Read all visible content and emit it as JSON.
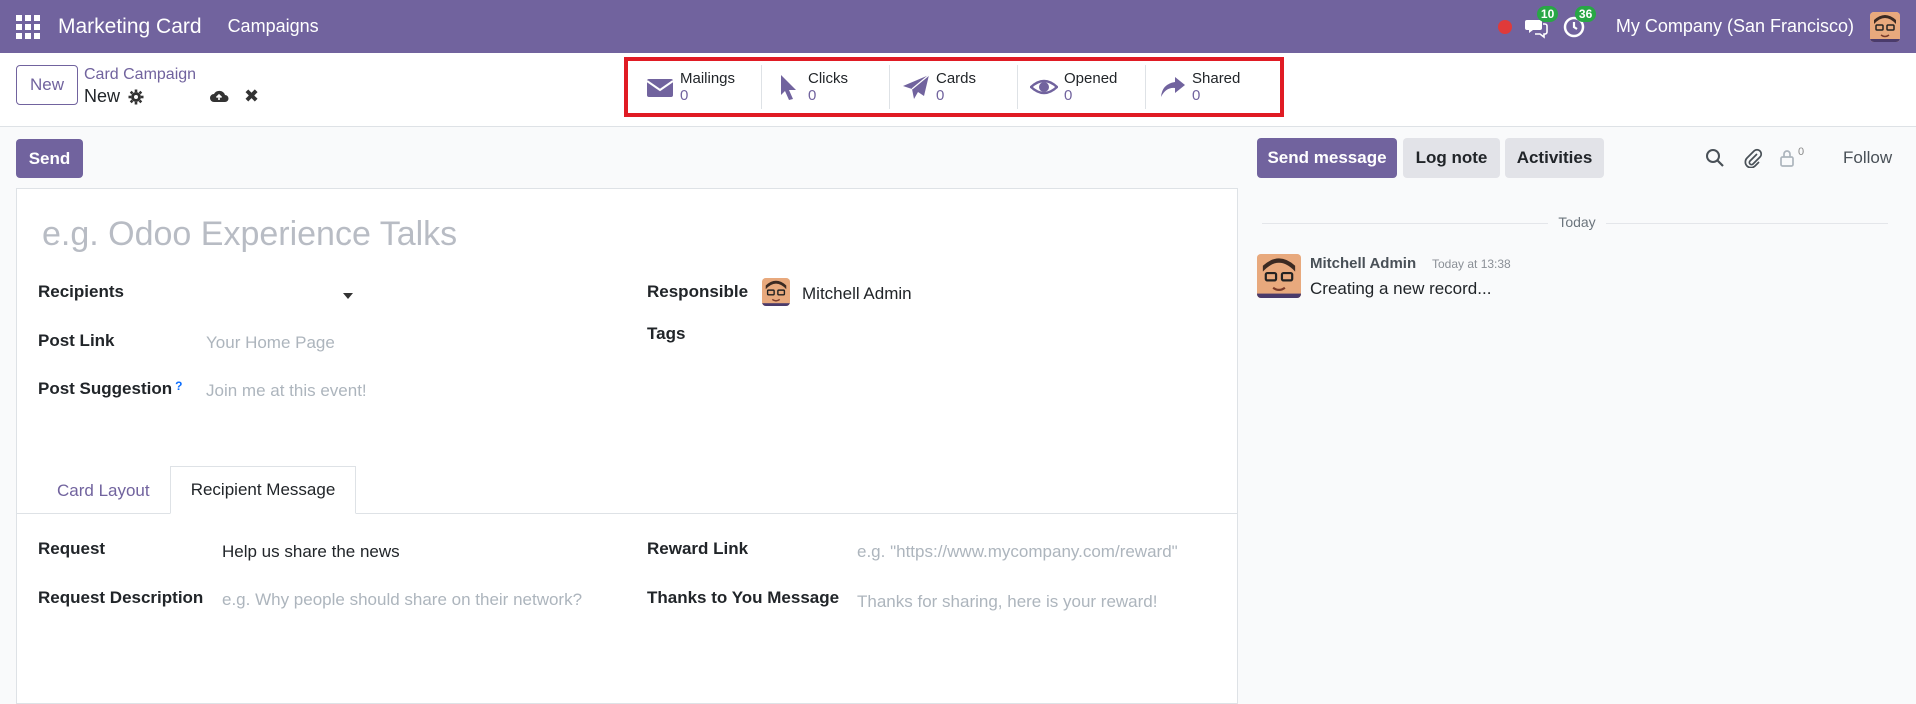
{
  "navbar": {
    "app_name": "Marketing Card",
    "menu": "Campaigns",
    "messages_badge": "10",
    "activities_badge": "36",
    "company": "My Company (San Francisco)",
    "accent_color": "#71639e"
  },
  "control_panel": {
    "new_label": "New",
    "breadcrumb_parent": "Card Campaign",
    "breadcrumb_current": "New",
    "stats": [
      {
        "icon": "envelope-icon",
        "label": "Mailings",
        "value": "0"
      },
      {
        "icon": "cursor-icon",
        "label": "Clicks",
        "value": "0"
      },
      {
        "icon": "paper-plane-icon",
        "label": "Cards",
        "value": "0"
      },
      {
        "icon": "eye-icon",
        "label": "Opened",
        "value": "0"
      },
      {
        "icon": "share-icon",
        "label": "Shared",
        "value": "0"
      }
    ]
  },
  "status_bar": {
    "send_label": "Send"
  },
  "form": {
    "name_placeholder": "e.g. Odoo Experience Talks",
    "recipients_label": "Recipients",
    "post_link_label": "Post Link",
    "post_link_placeholder": "Your Home Page",
    "post_suggestion_label": "Post Suggestion",
    "post_suggestion_help": "?",
    "post_suggestion_placeholder": "Join me at this event!",
    "responsible_label": "Responsible",
    "responsible_value": "Mitchell Admin",
    "tags_label": "Tags",
    "tabs": [
      {
        "label": "Card Layout",
        "active": false
      },
      {
        "label": "Recipient Message",
        "active": true
      }
    ],
    "request_label": "Request",
    "request_value": "Help us share the news",
    "request_description_label": "Request Description",
    "request_description_placeholder": "e.g. Why people should share on their network?",
    "reward_link_label": "Reward Link",
    "reward_link_placeholder": "e.g. \"https://www.mycompany.com/reward\"",
    "thanks_label": "Thanks to You Message",
    "thanks_placeholder": "Thanks for sharing, here is your reward!"
  },
  "chatter": {
    "send_message_label": "Send message",
    "log_note_label": "Log note",
    "activities_label": "Activities",
    "followers_count": "0",
    "follow_label": "Follow",
    "date_separator": "Today",
    "messages": [
      {
        "author": "Mitchell Admin",
        "time": "Today at 13:38",
        "body": "Creating a new record..."
      }
    ]
  }
}
